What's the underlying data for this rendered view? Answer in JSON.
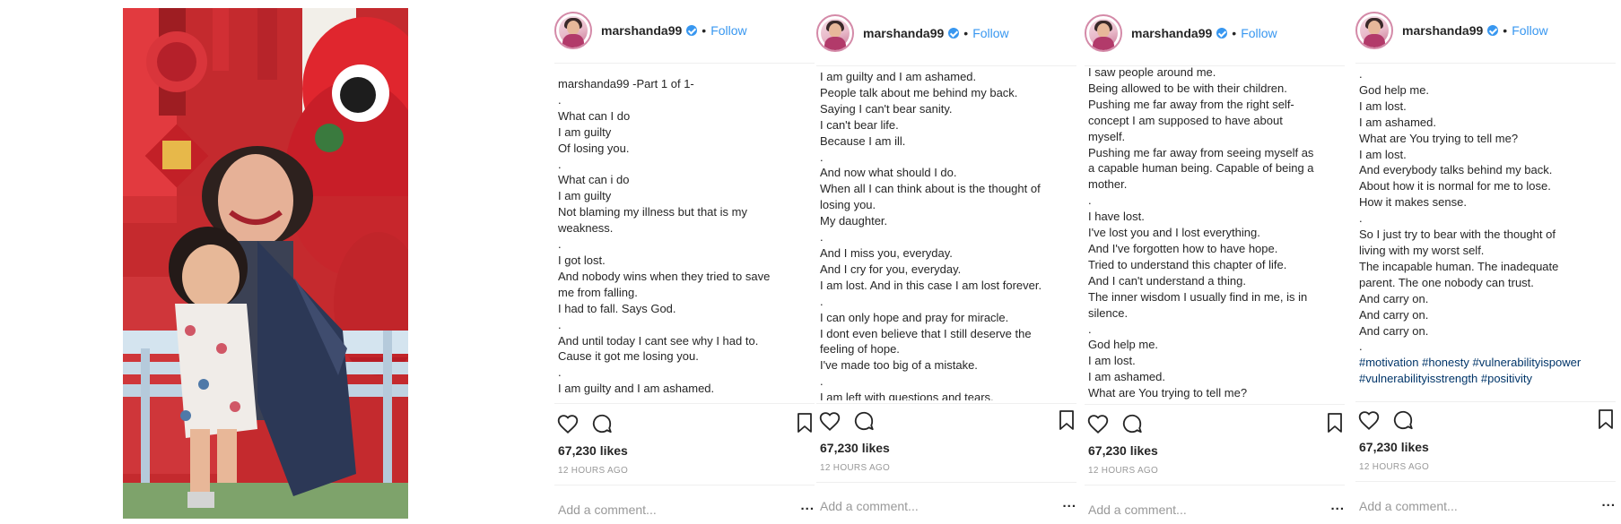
{
  "post": {
    "username": "marshanda99",
    "dot": "•",
    "follow_label": "Follow",
    "likes": "67,230 likes",
    "time": "12 HOURS AGO",
    "comment_placeholder": "Add a comment...",
    "more_label": "...",
    "accent_color": "#3897f0"
  },
  "panels": [
    {
      "lines": [
        "marshanda99 -Part 1 of 1-",
        ".",
        "What can I do",
        "I am guilty",
        "Of losing you.",
        ".",
        "What can i do",
        "I am guilty",
        "Not blaming my illness but that is my",
        "weakness.",
        ".",
        "I got lost.",
        "And nobody wins when they tried to save",
        "me from falling.",
        "I had to fall. Says God.",
        ".",
        "And until today I cant see why I had to.",
        "Cause it got me losing you.",
        ".",
        "I am guilty and I am ashamed."
      ]
    },
    {
      "lines": [
        "I am guilty and I am ashamed.",
        "People talk about me behind my back.",
        "Saying I can't bear sanity.",
        "I can't bear life.",
        "Because I am ill.",
        ".",
        "And now what should I do.",
        "When all I can think about is the thought of",
        "losing you.",
        "My daughter.",
        ".",
        "And I miss you, everyday.",
        "And I cry for you, everyday.",
        "I am lost. And in this case I am lost forever.",
        ".",
        "I can only hope and pray for miracle.",
        "I dont even believe that I still deserve the",
        "feeling of hope.",
        "I've made too big of a mistake.",
        ".",
        "I am left with questions and tears."
      ]
    },
    {
      "lines": [
        "I saw people around me.",
        "Being allowed to be with their children.",
        "Pushing me far away from the right self-",
        "concept I am supposed to have about",
        "myself.",
        "Pushing me far away from seeing myself as",
        "a capable human being. Capable of being a",
        "mother.",
        ".",
        "I have lost.",
        "I've lost you and I lost everything.",
        "And I've forgotten how to have hope.",
        "Tried to understand this chapter of life.",
        "And I can't understand a thing.",
        "The inner wisdom I usually find in me, is in",
        "silence.",
        ".",
        "God help me.",
        "I am lost.",
        "I am ashamed.",
        "What are You trying to tell me?"
      ]
    },
    {
      "lines": [
        ".",
        "God help me.",
        "I am lost.",
        "I am ashamed.",
        "What are You trying to tell me?",
        "I am lost.",
        "And everybody talks behind my back.",
        "About how it is normal for me to lose.",
        "How it makes sense.",
        ".",
        "So I just try to bear with the thought of",
        "living with my worst self.",
        "The incapable human. The inadequate",
        "parent. The one nobody can trust.",
        "And carry on.",
        "And carry on.",
        "And carry on.",
        "."
      ],
      "hashtags": [
        [
          "#motivation",
          "#honesty",
          "#vulnerabilityispower"
        ],
        [
          "#vulnerabilityisstrength",
          "#positivity"
        ]
      ]
    }
  ]
}
